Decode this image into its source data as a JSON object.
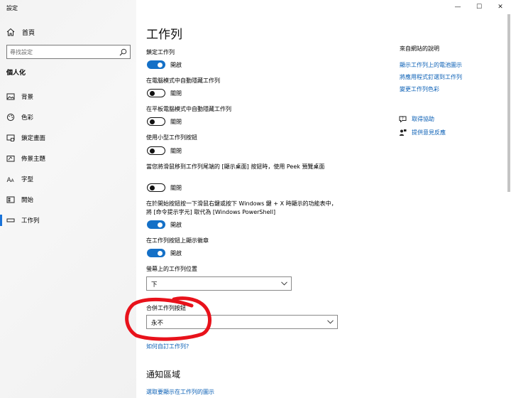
{
  "window": {
    "title": "設定",
    "controls": {
      "minimize": "—",
      "maximize": "☐",
      "close": "✕"
    }
  },
  "sidebar": {
    "home_label": "首頁",
    "search_placeholder": "尋找設定",
    "section_title": "個人化",
    "items": [
      {
        "label": "背景",
        "icon": "picture-icon"
      },
      {
        "label": "色彩",
        "icon": "palette-icon"
      },
      {
        "label": "鎖定畫面",
        "icon": "lock-screen-icon"
      },
      {
        "label": "佈景主題",
        "icon": "theme-icon"
      },
      {
        "label": "字型",
        "icon": "font-icon"
      },
      {
        "label": "開始",
        "icon": "start-icon"
      },
      {
        "label": "工作列",
        "icon": "taskbar-icon",
        "selected": true
      }
    ]
  },
  "main": {
    "title": "工作列",
    "settings": [
      {
        "label": "鎖定工作列",
        "state": "開啟",
        "on": true
      },
      {
        "label": "在電腦模式中自動隱藏工作列",
        "state": "關閉",
        "on": false
      },
      {
        "label": "在平板電腦模式中自動隱藏工作列",
        "state": "關閉",
        "on": false
      },
      {
        "label": "使用小型工作列按鈕",
        "state": "關閉",
        "on": false
      },
      {
        "label": "當您將滑鼠移到工作列尾端的 [顯示桌面] 按鈕時，使用 Peek 預覽桌面",
        "state": "關閉",
        "on": false
      },
      {
        "label": "在於開始按鈕按一下滑鼠右鍵或按下 Windows 鍵 + X 時顯示的功能表中，將 [命令提示字元] 取代為 [Windows PowerShell]",
        "state": "開啟",
        "on": true
      },
      {
        "label": "在工作列按鈕上顯示徽章",
        "state": "開啟",
        "on": true
      }
    ],
    "position_label": "螢幕上的工作列位置",
    "position_value": "下",
    "combine_label": "合併工作列按鈕",
    "combine_value": "永不",
    "customize_link": "如何自訂工作列?",
    "notification_heading": "通知區域",
    "notification_link": "選取要顯示在工作列的圖示"
  },
  "right": {
    "heading": "來自網站的說明",
    "links": [
      "顯示工作列上的電池圖示",
      "將應用程式釘選到工作列",
      "變更工作列色彩"
    ],
    "help": [
      {
        "label": "取得協助",
        "icon": "help-chat-icon"
      },
      {
        "label": "提供意見反應",
        "icon": "feedback-icon"
      }
    ]
  },
  "colors": {
    "accent": "#1470c7",
    "link": "#0a5fb5",
    "annotation": "#e8121b"
  }
}
